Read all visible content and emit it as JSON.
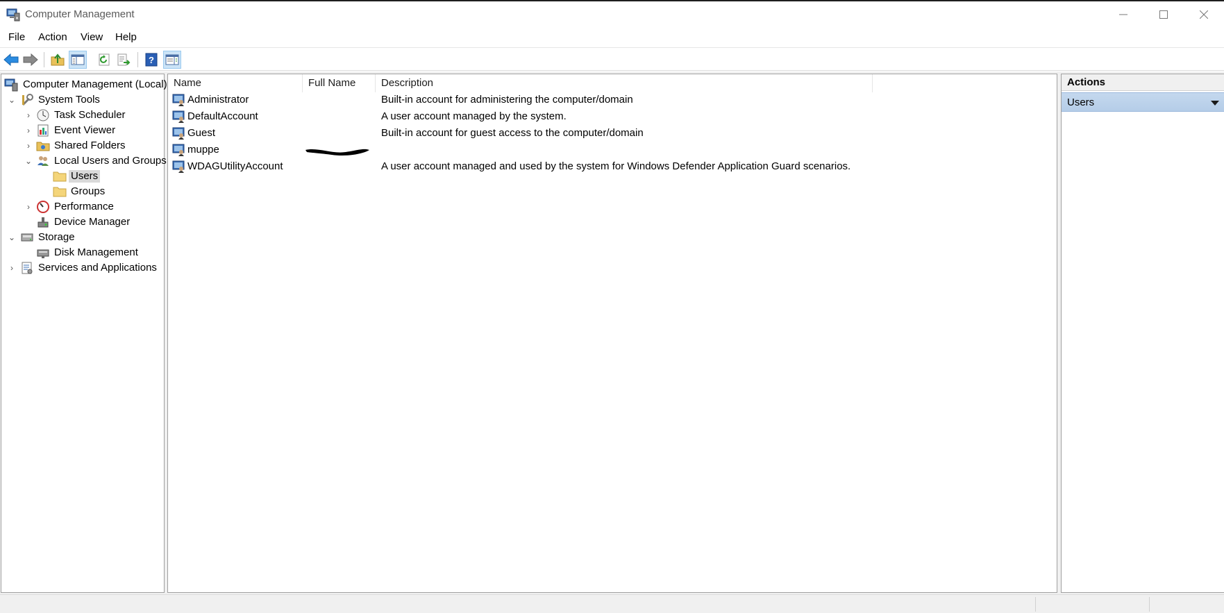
{
  "window": {
    "title": "Computer Management",
    "controls": {
      "minimize": "minimize-icon",
      "maximize": "maximize-icon",
      "close": "close-icon"
    }
  },
  "menu": [
    "File",
    "Action",
    "View",
    "Help"
  ],
  "toolbar": {
    "buttons": [
      "back-arrow-icon",
      "forward-arrow-icon",
      "up-folder-icon",
      "show-hide-console-tree-icon",
      "refresh-icon",
      "export-list-icon",
      "help-icon",
      "show-hide-action-pane-icon"
    ]
  },
  "tree": {
    "items": [
      {
        "label": "Computer Management (Local)"
      },
      {
        "label": "System Tools"
      },
      {
        "label": "Task Scheduler"
      },
      {
        "label": "Event Viewer"
      },
      {
        "label": "Shared Folders"
      },
      {
        "label": "Local Users and Groups"
      },
      {
        "label": "Users",
        "selected": true
      },
      {
        "label": "Groups"
      },
      {
        "label": "Performance"
      },
      {
        "label": "Device Manager"
      },
      {
        "label": "Storage"
      },
      {
        "label": "Disk Management"
      },
      {
        "label": "Services and Applications"
      }
    ]
  },
  "list": {
    "columns": [
      "Name",
      "Full Name",
      "Description"
    ],
    "rows": [
      {
        "name": "Administrator",
        "full_name": "",
        "description": "Built-in account for administering the computer/domain"
      },
      {
        "name": "DefaultAccount",
        "full_name": "",
        "description": "A user account managed by the system."
      },
      {
        "name": "Guest",
        "full_name": "",
        "description": "Built-in account for guest access to the computer/domain"
      },
      {
        "name": "muppe",
        "full_name": "",
        "description": ""
      },
      {
        "name": "WDAGUtilityAccount",
        "full_name": "",
        "description": "A user account managed and used by the system for Windows Defender Application Guard scenarios."
      }
    ]
  },
  "actions": {
    "header": "Actions",
    "section": "Users"
  },
  "colors": {
    "selection": "#d9d9d9",
    "actions_section": "#b9d1ea",
    "pressed_button": "#cce4f7"
  }
}
